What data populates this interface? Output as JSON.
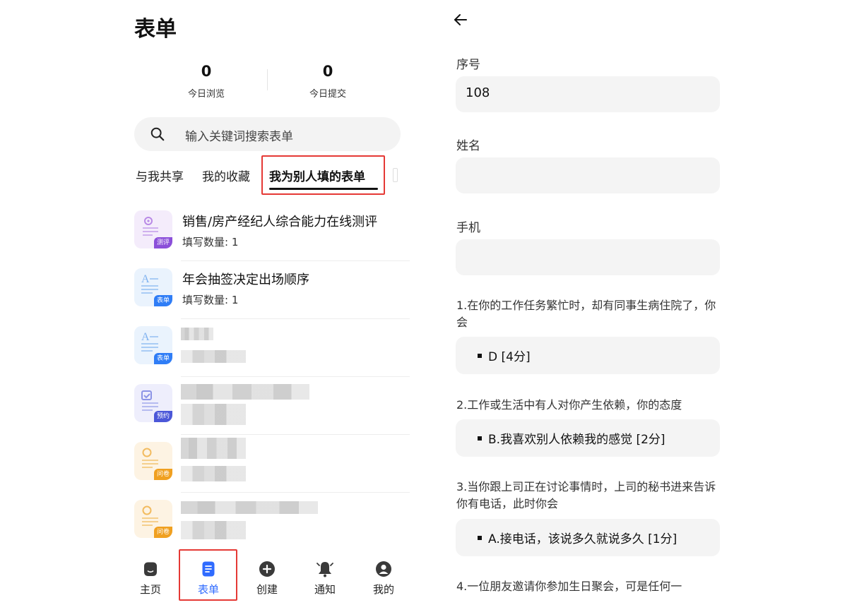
{
  "left": {
    "title": "表单",
    "stats": [
      {
        "value": "0",
        "label": "今日浏览"
      },
      {
        "value": "0",
        "label": "今日提交"
      }
    ],
    "search": {
      "placeholder": "输入关键词搜索表单",
      "icon": "search-icon"
    },
    "tabs": [
      {
        "label": "与我共享",
        "active": false
      },
      {
        "label": "我的收藏",
        "active": false
      },
      {
        "label": "我为别人填的表单",
        "active": true
      }
    ],
    "forms": [
      {
        "title": "销售/房产经纪人综合能力在线测评",
        "count_text": "填写数量: 1",
        "tag": "测评",
        "icon": "assessment-icon",
        "tag_color": "#8b4fd9",
        "bg": "#f4ecfb"
      },
      {
        "title": "年会抽签决定出场顺序",
        "count_text": "填写数量: 1",
        "tag": "表单",
        "icon": "form-icon",
        "tag_color": "#2f7df6",
        "bg": "#eaf3fd"
      },
      {
        "title": "",
        "count_text": "",
        "tag": "表单",
        "icon": "form-icon",
        "tag_color": "#2f7df6",
        "bg": "#eaf3fd"
      },
      {
        "title": "",
        "count_text": "",
        "tag": "预约",
        "icon": "appointment-icon",
        "tag_color": "#4b57d8",
        "bg": "#eeeefc"
      },
      {
        "title": "",
        "count_text": "",
        "tag": "问卷",
        "icon": "questionnaire-icon",
        "tag_color": "#f0a020",
        "bg": "#fdf3e3"
      },
      {
        "title": "",
        "count_text": "",
        "tag": "问卷",
        "icon": "questionnaire-icon",
        "tag_color": "#f0a020",
        "bg": "#fdf3e3"
      }
    ],
    "nav": [
      {
        "label": "主页",
        "icon": "home-icon",
        "active": false
      },
      {
        "label": "表单",
        "icon": "form-doc-icon",
        "active": true
      },
      {
        "label": "创建",
        "icon": "plus-circle-icon",
        "active": false
      },
      {
        "label": "通知",
        "icon": "bell-icon",
        "active": false
      },
      {
        "label": "我的",
        "icon": "user-icon",
        "active": false
      }
    ],
    "accent_color": "#2f6bff",
    "highlight_color": "#e53935"
  },
  "right": {
    "back_icon": "arrow-left-icon",
    "fields": [
      {
        "label": "序号",
        "value": "108"
      },
      {
        "label": "姓名",
        "value": ""
      },
      {
        "label": "手机",
        "value": ""
      }
    ],
    "questions": [
      {
        "text": "1.在你的工作任务繁忙时，却有同事生病住院了，你会",
        "answer": "D [4分]"
      },
      {
        "text": "2.工作或生活中有人对你产生依赖，你的态度",
        "answer": "B.我喜欢别人依赖我的感觉 [2分]"
      },
      {
        "text": "3.当你跟上司正在讨论事情时，上司的秘书进来告诉你有电话，此时你会",
        "answer": "A.接电话，该说多久就说多久 [1分]"
      },
      {
        "text": "4.一位朋友邀请你参加生日聚会，可是任何一"
      }
    ]
  }
}
